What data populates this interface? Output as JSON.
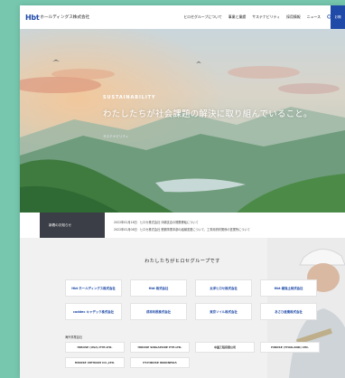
{
  "header": {
    "logo_mark": "Hbt",
    "logo_text": "ホールディングス株式会社",
    "nav": [
      "ヒロセグループについて",
      "事業と業績",
      "サステナビリティ",
      "採用情報",
      "ニュース"
    ],
    "contact": "お問"
  },
  "hero": {
    "kicker": "SUSTAINABILITY",
    "title": "わたしたちが社会課題の解決に取り組んでいること。",
    "subtitle": "サステナビリティ"
  },
  "news": {
    "label": "新着のお知らせ",
    "items": [
      "2022年02月18日　ヒロセ株式会社 沖縄支店の開業移転について",
      "2022年02月08日　ヒロセ株式会社 鉄鋼事業本部の組織変更について、工事用資材関係の営業所について"
    ]
  },
  "group": {
    "title": "わたしたちがヒロセグループです",
    "companies": [
      "Hbt ホールディングス株式会社",
      "Hbt 株式会社",
      "太洋ヒロセ株式会社",
      "Hbt 補強土株式会社",
      "caddec キャデック株式会社",
      "成幸利根株式会社",
      "東京ソイル株式会社",
      "あさひ産業株式会社"
    ],
    "overseas_label": "海外事業会社",
    "overseas": [
      "HIROSE (USA) PTE.LTD.",
      "HIROSE SINGAPORE PTE.LTD.",
      "中国工程有限公司",
      "HIROSE (THAILAND) LTD.",
      "HIROSE VIETNAM CO.,LTD.",
      "PT.HIROSE INDONESIA"
    ]
  }
}
